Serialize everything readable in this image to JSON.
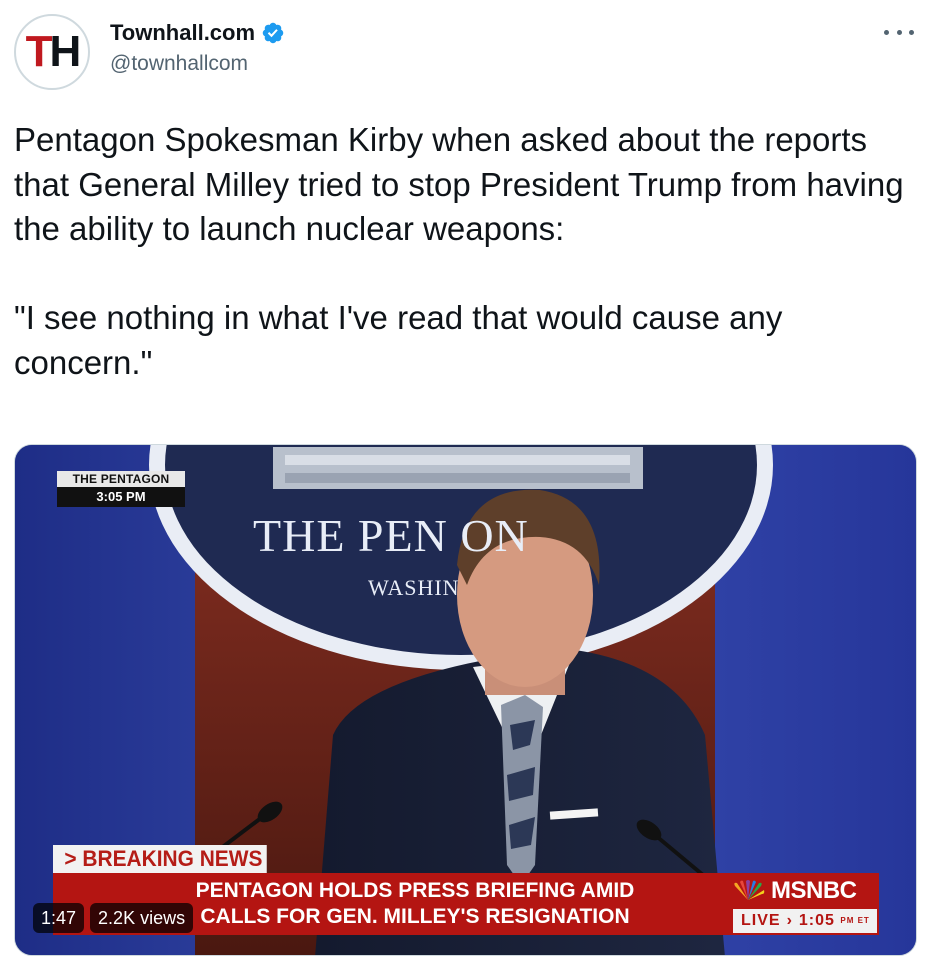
{
  "account": {
    "avatar_letters": "TH",
    "display_name": "Townhall.com",
    "handle": "@townhallcom",
    "verified": true,
    "verified_icon": "verified-badge-icon",
    "more_icon": "more-options-icon"
  },
  "tweet": {
    "text": "Pentagon Spokesman Kirby when asked about the reports that General Milley tried to stop President Trump from having the ability to launch nuclear weapons:\n\n\"I see nothing in what I've read that would cause any concern.\""
  },
  "media": {
    "location_label": "THE PENTAGON",
    "location_time": "3:05 PM",
    "seal_title": "THE PEN      ON",
    "seal_subtitle": "WASHIN",
    "breaking_label": "> BREAKING NEWS",
    "headline_line1": "PENTAGON HOLDS PRESS BRIEFING AMID",
    "headline_line2": "CALLS FOR GEN. MILLEY'S RESIGNATION",
    "network": "MSNBC",
    "live_label": "LIVE",
    "live_time": "1:05",
    "live_tz": "PM ET",
    "duration": "1:47",
    "views": "2.2K views"
  },
  "colors": {
    "verified_blue": "#1d9bf0",
    "ticker_red": "#b41512",
    "logo_red": "#c0191f"
  }
}
